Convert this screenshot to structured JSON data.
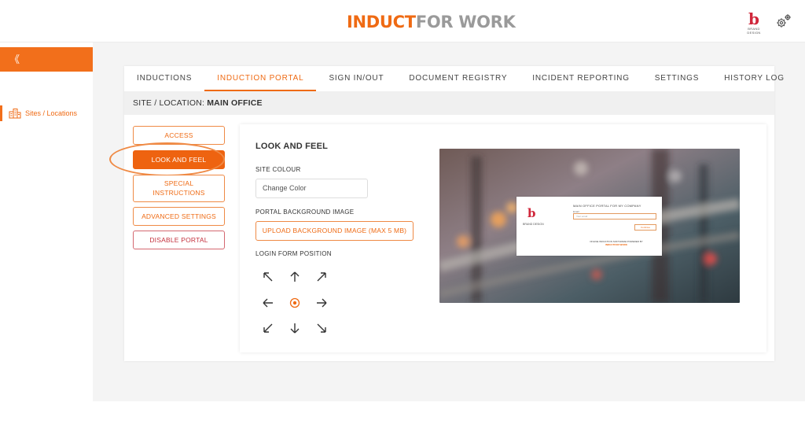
{
  "header": {
    "logo_part1": "INDUCT",
    "logo_part2": "FOR WORK",
    "brand_mark": "b",
    "brand_text": "BRAND DESIGN"
  },
  "sidebar": {
    "collapse_glyph": "《",
    "items": [
      {
        "label": "Sites / Locations",
        "icon": "buildings-icon"
      }
    ]
  },
  "tabs": [
    {
      "label": "INDUCTIONS",
      "active": false
    },
    {
      "label": "INDUCTION PORTAL",
      "active": true
    },
    {
      "label": "SIGN IN/OUT",
      "active": false
    },
    {
      "label": "DOCUMENT REGISTRY",
      "active": false
    },
    {
      "label": "INCIDENT REPORTING",
      "active": false
    },
    {
      "label": "SETTINGS",
      "active": false
    },
    {
      "label": "HISTORY LOG",
      "active": false
    }
  ],
  "site": {
    "prefix": "SITE / LOCATION: ",
    "name": "MAIN OFFICE"
  },
  "menu": {
    "access": "ACCESS",
    "look_and_feel": "LOOK AND FEEL",
    "special_instructions_1": "SPECIAL",
    "special_instructions_2": "INSTRUCTIONS",
    "advanced_settings": "ADVANCED SETTINGS",
    "disable_portal": "DISABLE PORTAL"
  },
  "panel": {
    "title": "LOOK AND FEEL",
    "site_colour_label": "SITE COLOUR",
    "change_color": "Change Color",
    "bg_image_label": "PORTAL BACKGROUND IMAGE",
    "upload_button": "UPLOAD BACKGROUND IMAGE (MAX 5 MB)",
    "login_position_label": "LOGIN FORM POSITION"
  },
  "preview": {
    "brand_mark": "b",
    "brand_text": "BRAND DESIGN",
    "title": "MAIN OFFICE PORTAL FOR MY COMPANY",
    "email_label": "Email",
    "email_placeholder": "Your email",
    "continue": "Continue",
    "footer": "ONLINE INDUCTION SOFTWARE POWERED BY",
    "footer_logo": "INDUCTFOR WORK"
  },
  "colors": {
    "accent": "#ef6a13",
    "danger": "#c4323e"
  }
}
